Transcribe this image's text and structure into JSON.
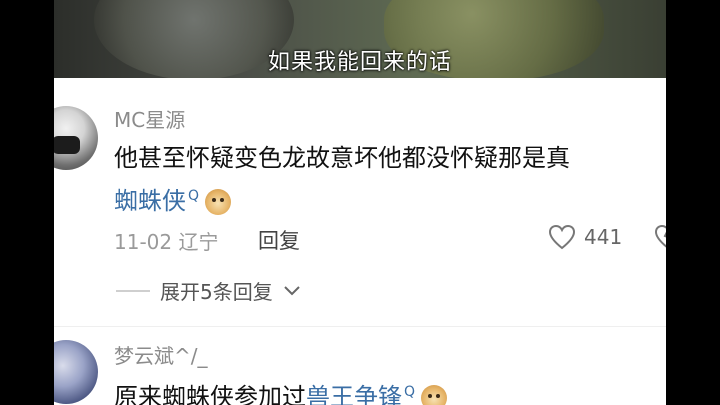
{
  "video": {
    "subtitle": "如果我能回来的话"
  },
  "comments": [
    {
      "username": "MC星源",
      "text_before": "他甚至怀疑变色龙故意坏他都没怀疑那是真",
      "link_text": "蜘蛛侠",
      "search_mark": "Q",
      "date_location": "11-02 辽宁",
      "reply_label": "回复",
      "like_count": "441",
      "expand_replies": "展开5条回复"
    },
    {
      "username": "梦云斌^/_",
      "text_before": "原来蜘蛛侠参加过",
      "link_text": "兽王争锋",
      "search_mark": "Q"
    }
  ],
  "icons": {
    "like": "heart-outline-icon",
    "dislike": "heart-broken-icon",
    "expand": "chevron-down-icon",
    "search_link": "search-icon",
    "emoji": "doge-emoji-icon"
  },
  "colors": {
    "link": "#3a6ea5",
    "username": "#8b8b8b",
    "meta": "#9a9a9a"
  }
}
